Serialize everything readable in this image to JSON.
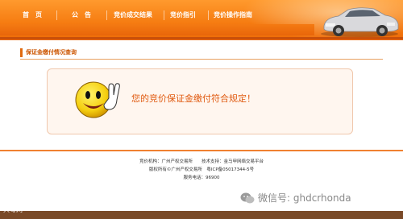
{
  "nav": {
    "items": [
      {
        "label": "首　页"
      },
      {
        "label": "公　告"
      },
      {
        "label": "竞价成交结果"
      },
      {
        "label": "竞价指引"
      },
      {
        "label": "竞价操作指南"
      }
    ]
  },
  "section": {
    "title": "保证金缴付情况查询"
  },
  "panel": {
    "message": "您的竞价保证金缴付符合规定！"
  },
  "footer": {
    "row1": "竞价机构：广州产权交易所　　技术支持：金马甲网络交易平台",
    "row2": "版权所有©广州产权交易所　粤ICP备05017344-5号",
    "row3": "服务电话：96900"
  },
  "watermark": {
    "corner": "大粤网",
    "wechat": "微信号: ghdcrhonda"
  },
  "colors": {
    "accent": "#f57a10",
    "message": "#e05a10"
  },
  "icons": [
    "car-image",
    "smiley-thumbs-up-icon",
    "wechat-icon"
  ]
}
